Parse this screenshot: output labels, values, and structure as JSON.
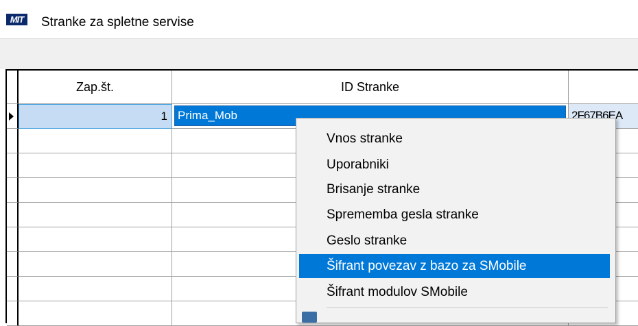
{
  "window": {
    "icon_text": "MIT",
    "title": "Stranke za spletne servise"
  },
  "grid": {
    "columns": [
      "Zap.št.",
      "ID Stranke",
      ""
    ],
    "rows": [
      {
        "zap_st": "1",
        "id_stranke": "Prima_Mob",
        "col3": "2F67B6EA"
      }
    ]
  },
  "context_menu": {
    "items": [
      "Vnos stranke",
      "Uporabniki",
      "Brisanje stranke",
      "Sprememba gesla stranke",
      "Geslo stranke",
      "Šifrant povezav z bazo za SMobile",
      "Šifrant modulov SMobile"
    ],
    "highlighted": "Šifrant povezav z bazo za SMobile"
  }
}
